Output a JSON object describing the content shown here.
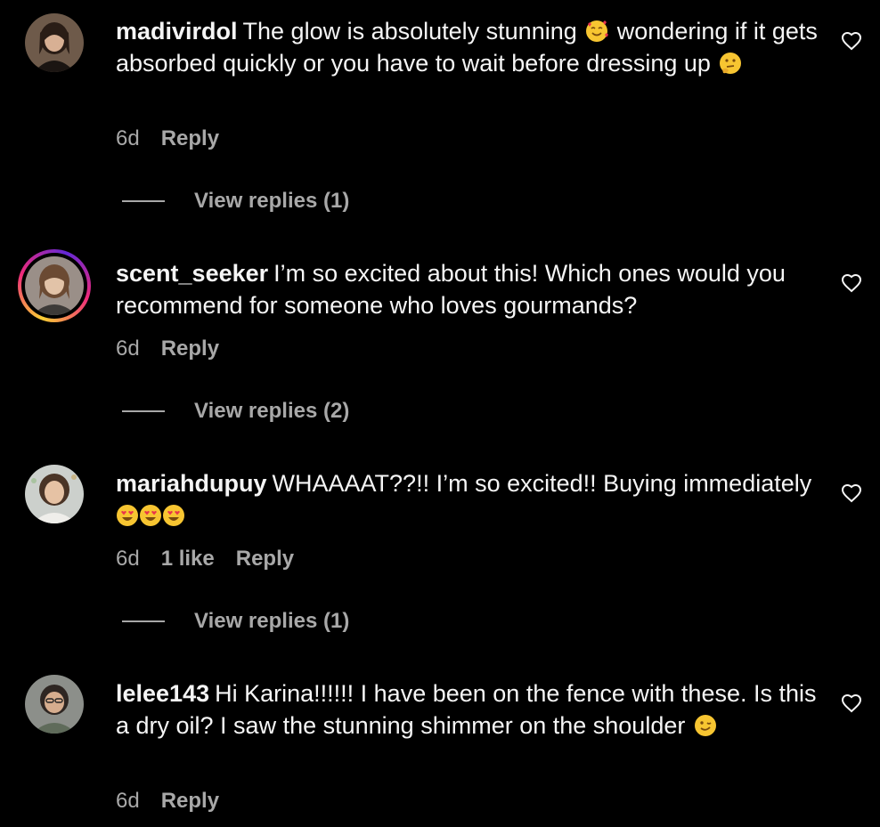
{
  "colors": {
    "background": "#000000",
    "text": "#f5f5f5",
    "muted": "#a8a8a8",
    "story_ring": [
      "#f9ce34",
      "#ee2a7b",
      "#6228d7"
    ]
  },
  "comments": [
    {
      "username": "madivirdol",
      "text_1": "The glow is absolutely stunning",
      "emoji_1": "smiling-face-with-hearts",
      "text_2": "wondering if it gets absorbed quickly or you have to wait before dressing up",
      "emoji_2": "thinking-face",
      "time": "6d",
      "reply_label": "Reply",
      "view_replies": "View replies (1)"
    },
    {
      "username": "scent_seeker",
      "text_1": "I’m so excited about this! Which ones would you recommend for someone who loves gourmands?",
      "time": "6d",
      "reply_label": "Reply",
      "view_replies": "View replies (2)",
      "has_story": true
    },
    {
      "username": "mariahdupuy",
      "text_1": "WHAAAAT??!! I’m so excited!! Buying immediately",
      "emoji_1": "heart-eyes x3",
      "time": "6d",
      "likes": "1 like",
      "reply_label": "Reply",
      "view_replies": "View replies (1)"
    },
    {
      "username": "lelee143",
      "text_1": "Hi Karina!!!!!! I have been on the fence with these. Is this a dry oil? I saw the stunning shimmer on the shoulder",
      "emoji_1": "winking-face",
      "time": "6d",
      "reply_label": "Reply"
    }
  ]
}
